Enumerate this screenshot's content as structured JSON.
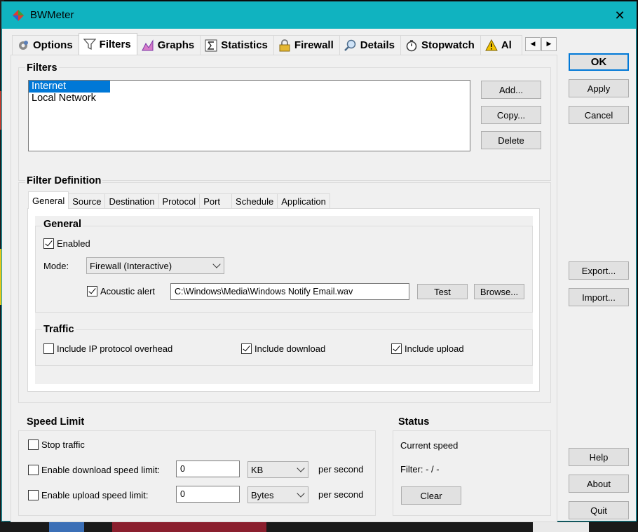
{
  "window": {
    "title": "BWMeter",
    "close_glyph": "✕"
  },
  "main_tabs": [
    {
      "label": "Options",
      "icon": "gear-icon"
    },
    {
      "label": "Filters",
      "icon": "funnel-icon"
    },
    {
      "label": "Graphs",
      "icon": "graph-icon"
    },
    {
      "label": "Statistics",
      "icon": "sigma-icon"
    },
    {
      "label": "Firewall",
      "icon": "lock-icon"
    },
    {
      "label": "Details",
      "icon": "magnifier-icon"
    },
    {
      "label": "Stopwatch",
      "icon": "stopwatch-icon"
    },
    {
      "label": "Al",
      "icon": "warning-icon"
    }
  ],
  "tab_scroll": {
    "left": "◀",
    "right": "▶"
  },
  "filters": {
    "title": "Filters",
    "items": [
      "Internet",
      "Local Network"
    ],
    "add_label": "Add...",
    "copy_label": "Copy...",
    "delete_label": "Delete"
  },
  "filter_definition": {
    "title": "Filter Definition",
    "tabs": [
      "General",
      "Source",
      "Destination",
      "Protocol",
      "Port",
      "Schedule",
      "Application"
    ],
    "general": {
      "title": "General",
      "enabled_label": "Enabled",
      "enabled": true,
      "mode_label": "Mode:",
      "mode_value": "Firewall (Interactive)",
      "acoustic_label": "Acoustic alert",
      "acoustic": true,
      "sound_path": "C:\\Windows\\Media\\Windows Notify Email.wav",
      "test_label": "Test",
      "browse_label": "Browse..."
    },
    "traffic": {
      "title": "Traffic",
      "ip_overhead_label": "Include IP protocol overhead",
      "ip_overhead": false,
      "download_label": "Include download",
      "download": true,
      "upload_label": "Include upload",
      "upload": true
    }
  },
  "speed_limit": {
    "title": "Speed Limit",
    "stop_label": "Stop traffic",
    "download_label": "Enable download speed limit:",
    "download_value": "0",
    "download_unit": "KB",
    "upload_label": "Enable upload speed limit:",
    "upload_value": "0",
    "upload_unit": "Bytes",
    "per_second": "per second"
  },
  "status": {
    "title": "Status",
    "current_speed": "Current speed",
    "filter_line": "Filter: - / -",
    "clear_label": "Clear"
  },
  "side_buttons": {
    "ok": "OK",
    "apply": "Apply",
    "cancel": "Cancel",
    "export": "Export...",
    "import": "Import...",
    "help": "Help",
    "about": "About",
    "quit": "Quit"
  },
  "colors": {
    "titlebar": "#10b3c0",
    "selection": "#0078d7"
  }
}
